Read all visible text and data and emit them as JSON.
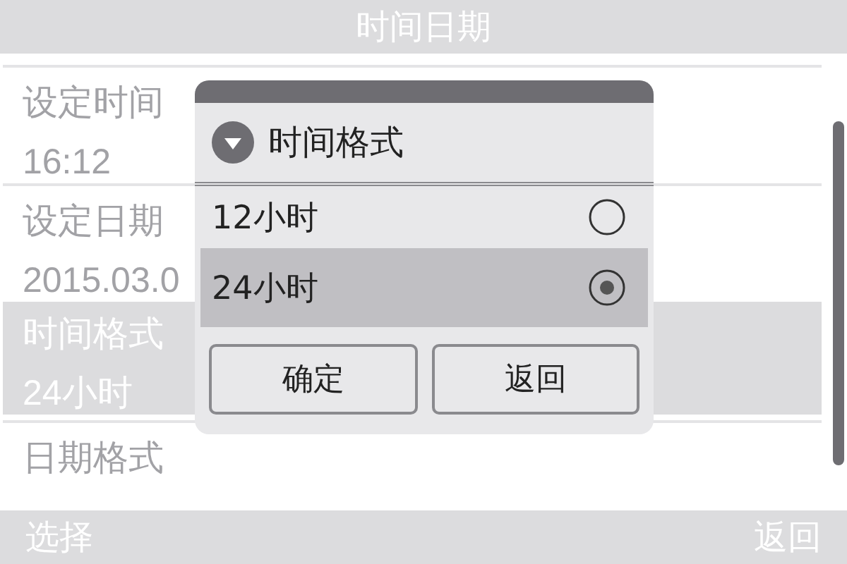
{
  "header": {
    "title": "时间日期"
  },
  "items": [
    {
      "label": "设定时间",
      "value": "16:12",
      "selected": false
    },
    {
      "label": "设定日期",
      "value": "2015.03.0",
      "selected": false
    },
    {
      "label": "时间格式",
      "value": "24小时",
      "selected": true
    },
    {
      "label": "日期格式",
      "selected": false
    }
  ],
  "dialog": {
    "title": "时间格式",
    "options": [
      {
        "label": "12小时",
        "selected": false
      },
      {
        "label": "24小时",
        "selected": true
      }
    ],
    "buttons": [
      "确定",
      "返回"
    ]
  },
  "footer": {
    "left": "选择",
    "right": "返回"
  }
}
